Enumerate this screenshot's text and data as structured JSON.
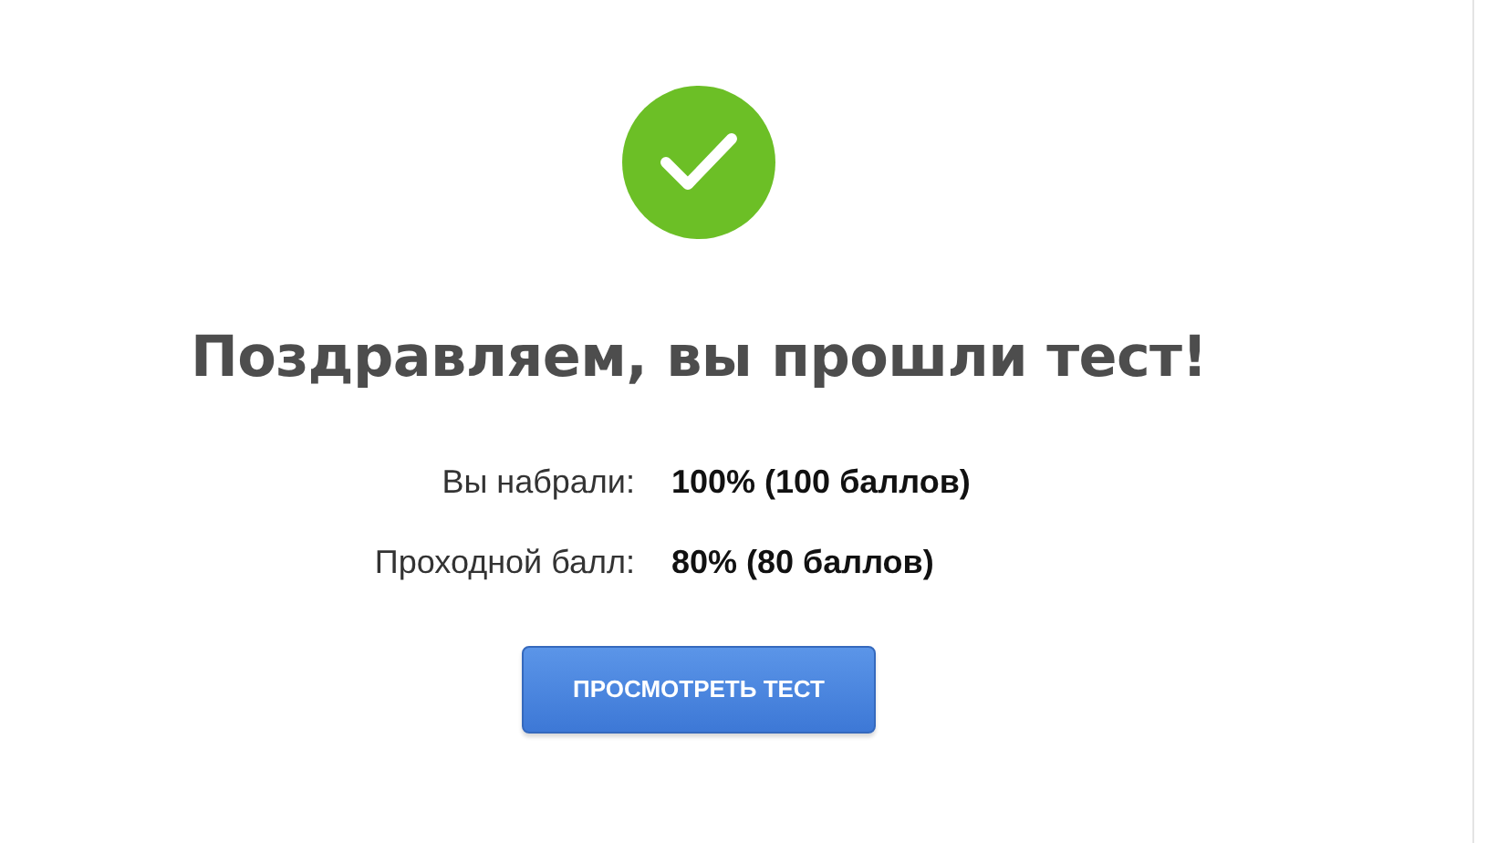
{
  "result": {
    "passed": true,
    "title": "Поздравляем, вы прошли тест!"
  },
  "scores": [
    {
      "label": "Вы набрали:",
      "value": "100% (100 баллов)"
    },
    {
      "label": "Проходной балл:",
      "value": "80% (80 баллов)"
    }
  ],
  "button": {
    "label": "ПРОСМОТРЕТЬ ТЕСТ"
  }
}
